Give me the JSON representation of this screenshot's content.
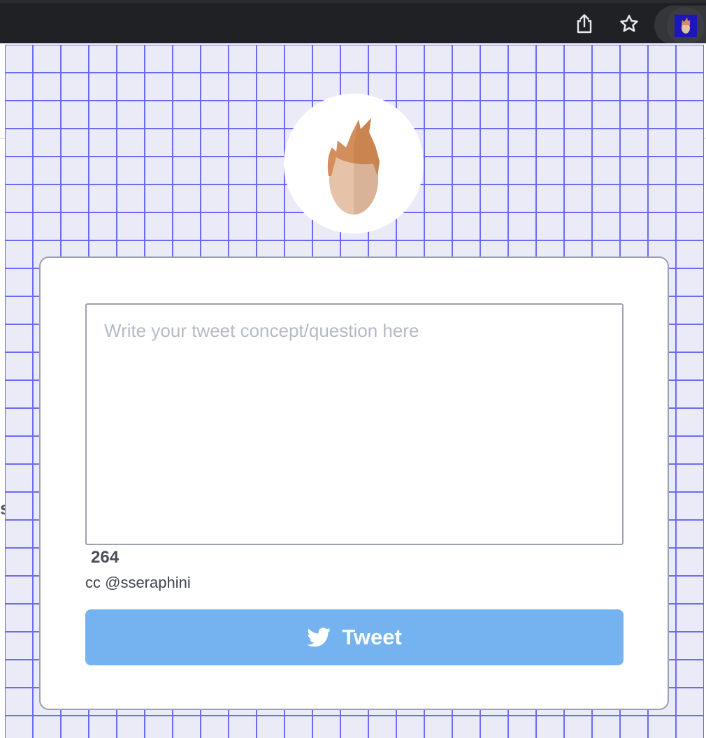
{
  "browser": {
    "share_icon": "share-icon",
    "bookmark_icon": "star-icon",
    "extension_icon": "extension-avatar-icon"
  },
  "popup": {
    "grid_color": "#6c6cf0",
    "background_color": "#ebeaf7",
    "avatar_icon": "avatar-face-icon",
    "tweet_input": {
      "value": "",
      "placeholder": "Write your tweet concept/question here"
    },
    "char_count": "264",
    "cc_text": "cc @sseraphini",
    "tweet_button": {
      "label": "Tweet",
      "icon": "twitter-bird-icon",
      "color": "#74b3ef"
    }
  },
  "background_page": {
    "partial_letter": "s"
  }
}
